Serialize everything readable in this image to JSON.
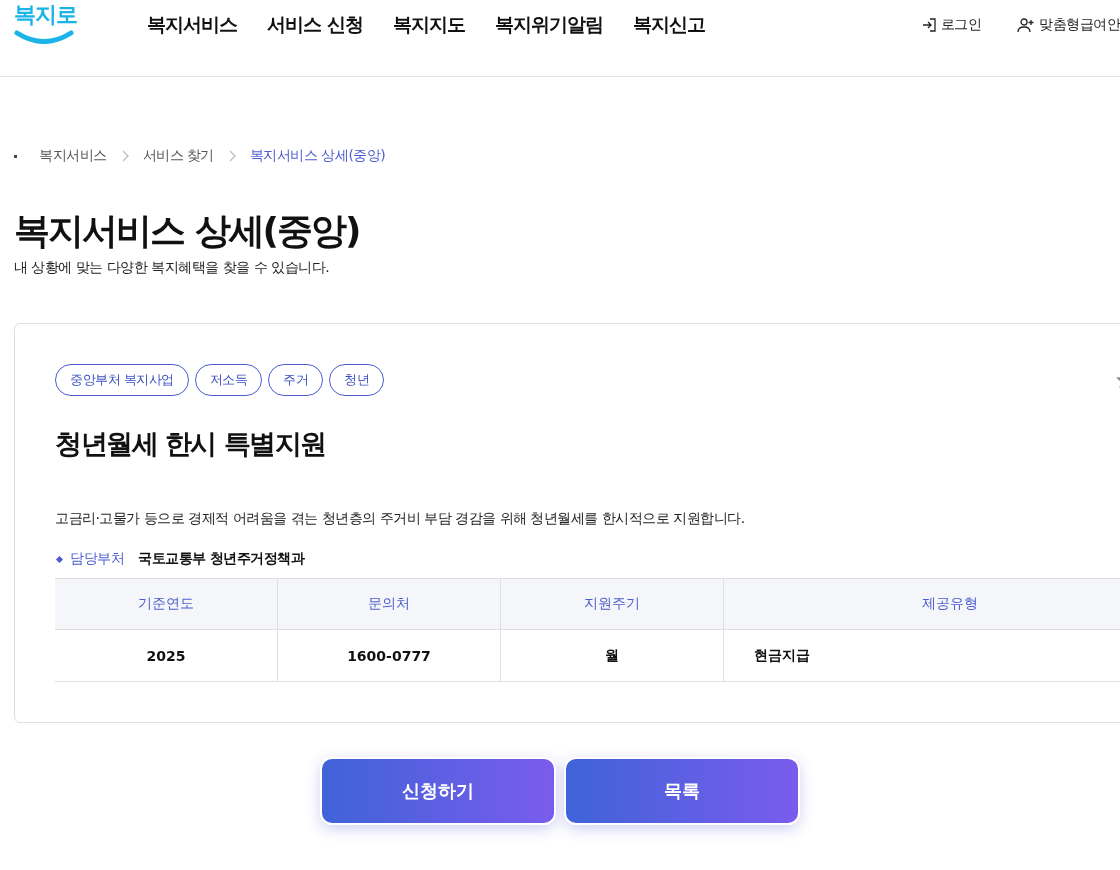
{
  "header": {
    "logo": "복지로",
    "nav": [
      {
        "label": "복지서비스"
      },
      {
        "label": "서비스 신청"
      },
      {
        "label": "복지지도"
      },
      {
        "label": "복지위기알림"
      },
      {
        "label": "복지신고"
      }
    ],
    "utility": [
      {
        "kind": "login",
        "label": "로그인"
      },
      {
        "kind": "user",
        "label": "맞춤형급여안"
      }
    ]
  },
  "breadcrumb": [
    {
      "label": "복지서비스",
      "current": false
    },
    {
      "label": "서비스 찾기",
      "current": false
    },
    {
      "label": "복지서비스 상세(중앙)",
      "current": true
    }
  ],
  "page_title": "복지서비스 상세(중앙)",
  "page_subtitle": "내 상황에 맞는 다양한 복지혜택을 찾을 수 있습니다.",
  "service": {
    "tags": [
      "중앙부처 복지사업",
      "저소득",
      "주거",
      "청년"
    ],
    "title": "청년월세 한시 특별지원",
    "description": "고금리·고물가 등으로 경제적 어려움을 겪는 청년층의 주거비 부담 경감을 위해 청년월세를 한시적으로 지원합니다.",
    "department": {
      "label": "담당부처",
      "value": "국토교통부 청년주거정책과"
    },
    "table": {
      "columns": [
        "기준연도",
        "문의처",
        "지원주기",
        "제공유형"
      ],
      "rows": [
        [
          "2025",
          "1600-0777",
          "월",
          "현금지급"
        ]
      ]
    }
  },
  "buttons": [
    {
      "label": "신청하기"
    },
    {
      "label": "목록"
    }
  ]
}
